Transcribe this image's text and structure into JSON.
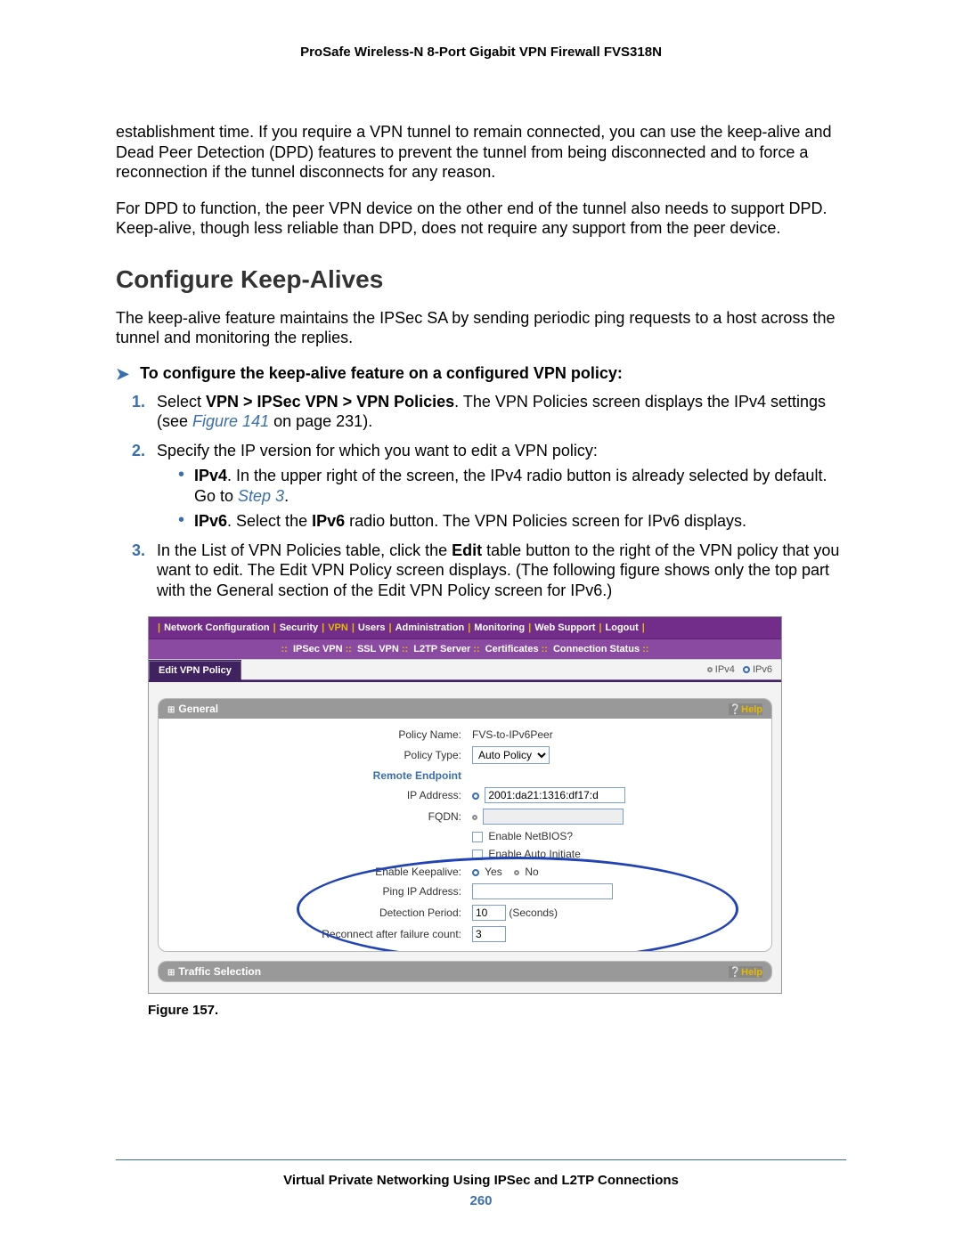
{
  "doc": {
    "header_title": "ProSafe Wireless-N 8-Port Gigabit VPN Firewall FVS318N",
    "para1": "establishment time. If you require a VPN tunnel to remain connected, you can use the keep-alive and Dead Peer Detection (DPD) features to prevent the tunnel from being disconnected and to force a reconnection if the tunnel disconnects for any reason.",
    "para2": "For DPD to function, the peer VPN device on the other end of the tunnel also needs to support DPD. Keep-alive, though less reliable than DPD, does not require any support from the peer device.",
    "h2": "Configure Keep-Alives",
    "para3": "The keep-alive feature maintains the IPSec SA by sending periodic ping requests to a host across the tunnel and monitoring the replies.",
    "lead": "To configure the keep-alive feature on a configured VPN policy:",
    "step1_pre": "Select ",
    "step1_bold": "VPN > IPSec VPN > VPN Policies",
    "step1_mid": ". The VPN Policies screen displays the IPv4 settings (see ",
    "step1_link": "Figure 141",
    "step1_after": " on page 231).",
    "step2": "Specify the IP version for which you want to edit a VPN policy:",
    "ipv4_bold": "IPv4",
    "ipv4_text": ". In the upper right of the screen, the IPv4 radio button is already selected by default. Go to ",
    "ipv4_link": "Step 3",
    "ipv4_dot": ".",
    "ipv6_bold": "IPv6",
    "ipv6_text_a": ". Select the ",
    "ipv6_bold2": "IPv6",
    "ipv6_text_b": " radio button. The VPN Policies screen for IPv6 displays.",
    "step3_a": "In the List of VPN Policies table, click the ",
    "step3_edit": "Edit",
    "step3_b": " table button to the right of the VPN policy that you want to edit. The Edit VPN Policy screen displays. (The following figure shows only the top part with the General section of the Edit VPN Policy screen for IPv6.)",
    "fig_caption": "Figure 157."
  },
  "fig": {
    "menu": [
      "Network Configuration",
      "Security",
      "VPN",
      "Users",
      "Administration",
      "Monitoring",
      "Web Support",
      "Logout"
    ],
    "menu_active": "VPN",
    "submenu": [
      "IPSec VPN",
      "SSL VPN",
      "L2TP Server",
      "Certificates",
      "Connection Status"
    ],
    "tab": "Edit VPN Policy",
    "ip_v4_label": "IPv4",
    "ip_v6_label": "IPv6",
    "general_title": "General",
    "help_label": "Help",
    "traffic_title": "Traffic Selection",
    "rows": {
      "policy_name_label": "Policy Name:",
      "policy_name_value": "FVS-to-IPv6Peer",
      "policy_type_label": "Policy Type:",
      "policy_type_value": "Auto Policy",
      "remote_endpoint": "Remote Endpoint",
      "ip_addr_label": "IP Address:",
      "ip_addr_value": "2001:da21:1316:df17:d",
      "fqdn_label": "FQDN:",
      "netbios_label": "Enable NetBIOS?",
      "autoinit_label": "Enable Auto Initiate",
      "keepalive_label": "Enable Keepalive:",
      "yes": "Yes",
      "no": "No",
      "ping_ip_label": "Ping IP Address:",
      "detection_label": "Detection Period:",
      "detection_value": "10",
      "detection_unit": "(Seconds)",
      "reconnect_label": "Reconnect after failure count:",
      "reconnect_value": "3"
    }
  },
  "footer": {
    "line1": "Virtual Private Networking Using IPSec and L2TP Connections",
    "page": "260"
  }
}
